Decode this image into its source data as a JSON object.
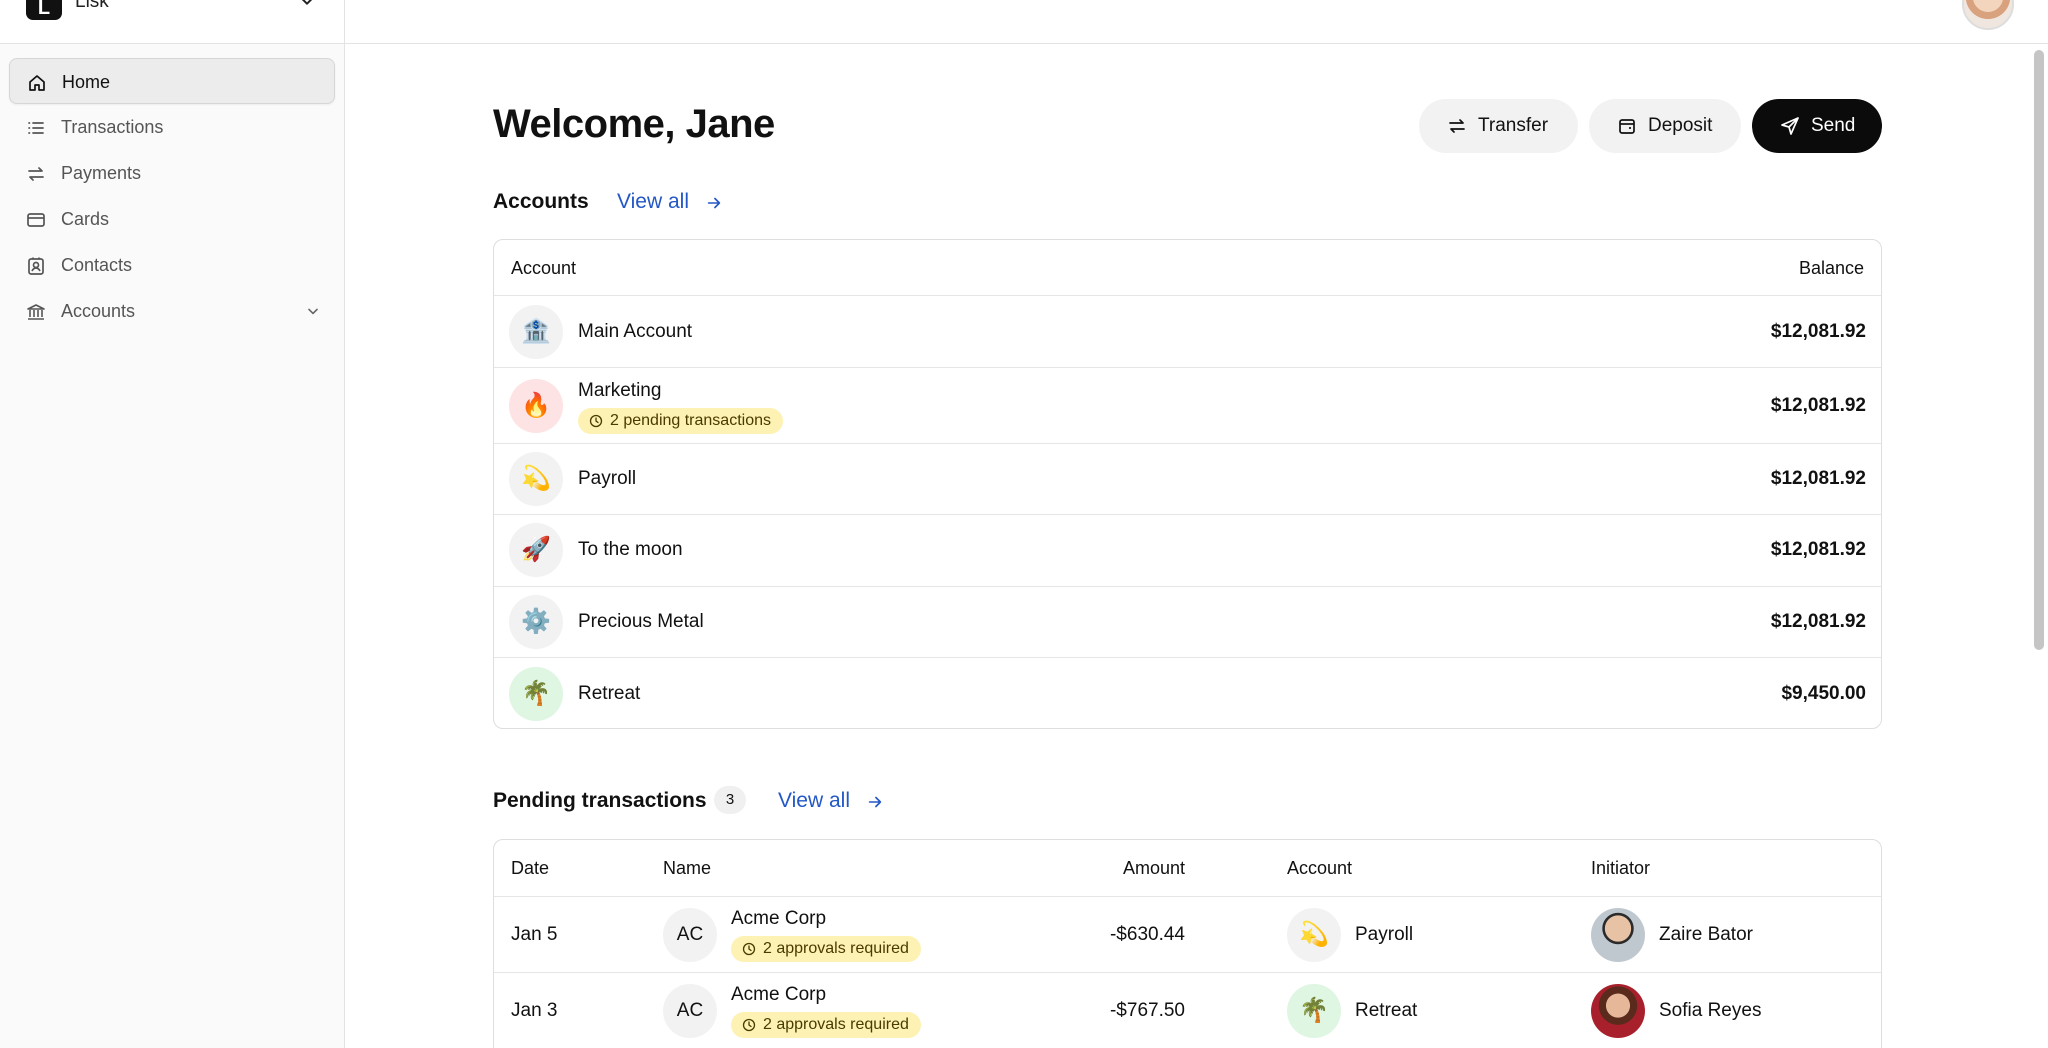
{
  "brand": {
    "name": "Lisk",
    "logo_letter": "L"
  },
  "sidebar": {
    "items": [
      {
        "label": "Home",
        "icon": "home-icon"
      },
      {
        "label": "Transactions",
        "icon": "list-icon"
      },
      {
        "label": "Payments",
        "icon": "arrows-icon"
      },
      {
        "label": "Cards",
        "icon": "card-icon"
      },
      {
        "label": "Contacts",
        "icon": "contacts-icon"
      },
      {
        "label": "Accounts",
        "icon": "bank-icon"
      }
    ]
  },
  "header": {
    "title": "Welcome, Jane",
    "transfer_label": "Transfer",
    "deposit_label": "Deposit",
    "send_label": "Send"
  },
  "accounts": {
    "title": "Accounts",
    "view_all": "View all",
    "col_account": "Account",
    "col_balance": "Balance",
    "rows": [
      {
        "name": "Main Account",
        "emoji": "🏦",
        "balance": "$12,081.92"
      },
      {
        "name": "Marketing",
        "emoji": "🔥",
        "badge": "2 pending transactions",
        "balance": "$12,081.92"
      },
      {
        "name": "Payroll",
        "emoji": "💫",
        "balance": "$12,081.92"
      },
      {
        "name": "To the moon",
        "emoji": "🚀",
        "balance": "$12,081.92"
      },
      {
        "name": "Precious Metal",
        "emoji": "⚙️",
        "balance": "$12,081.92"
      },
      {
        "name": "Retreat",
        "emoji": "🌴",
        "balance": "$9,450.00"
      }
    ]
  },
  "pending": {
    "title": "Pending transactions",
    "count": "3",
    "view_all": "View all",
    "cols": {
      "date": "Date",
      "name": "Name",
      "amount": "Amount",
      "account": "Account",
      "initiator": "Initiator"
    },
    "rows": [
      {
        "date": "Jan 5",
        "initials": "AC",
        "name": "Acme Corp",
        "badge": "2 approvals required",
        "amount": "-$630.44",
        "account": "Payroll",
        "account_emoji": "💫",
        "initiator": "Zaire Bator"
      },
      {
        "date": "Jan 3",
        "initials": "AC",
        "name": "Acme Corp",
        "badge": "2 approvals required",
        "amount": "-$767.50",
        "account": "Retreat",
        "account_emoji": "🌴",
        "initiator": "Sofia Reyes"
      }
    ]
  }
}
